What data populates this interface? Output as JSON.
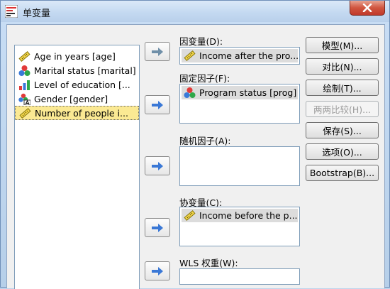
{
  "window": {
    "title": "单变量",
    "close_label": "X"
  },
  "variables": [
    {
      "label": "Age in years [age]",
      "icon": "scale-ruler-icon",
      "selected": false
    },
    {
      "label": "Marital status [marital]",
      "icon": "nominal-balls-icon",
      "selected": false
    },
    {
      "label": "Level of education [...",
      "icon": "ordinal-bars-icon",
      "selected": false
    },
    {
      "label": "Gender [gender]",
      "icon": "nominal-string-icon",
      "selected": false
    },
    {
      "label": "Number of people i...",
      "icon": "scale-ruler-icon",
      "selected": true
    }
  ],
  "fields": {
    "dependent": {
      "label": "因变量(D):",
      "value": "Income after the pro..."
    },
    "fixed": {
      "label": "固定因子(F):",
      "value": "Program status [prog]"
    },
    "random": {
      "label": "随机因子(A):"
    },
    "covariate": {
      "label": "协变量(C):",
      "value": "Income before the p..."
    },
    "wls": {
      "label": "WLS 权重(W):"
    }
  },
  "buttons": [
    {
      "label": "模型(M)...",
      "enabled": true
    },
    {
      "label": "对比(N)...",
      "enabled": true
    },
    {
      "label": "绘制(T)...",
      "enabled": true
    },
    {
      "label": "两两比较(H)...",
      "enabled": false
    },
    {
      "label": "保存(S)...",
      "enabled": true
    },
    {
      "label": "选项(O)...",
      "enabled": true
    },
    {
      "label": "Bootstrap(B)...",
      "enabled": true
    }
  ],
  "colors": {
    "selection": "#fbe993",
    "arrow": "#3a78d6",
    "arrow_disabled": "#6f8fa8",
    "close": "#c0392b"
  }
}
